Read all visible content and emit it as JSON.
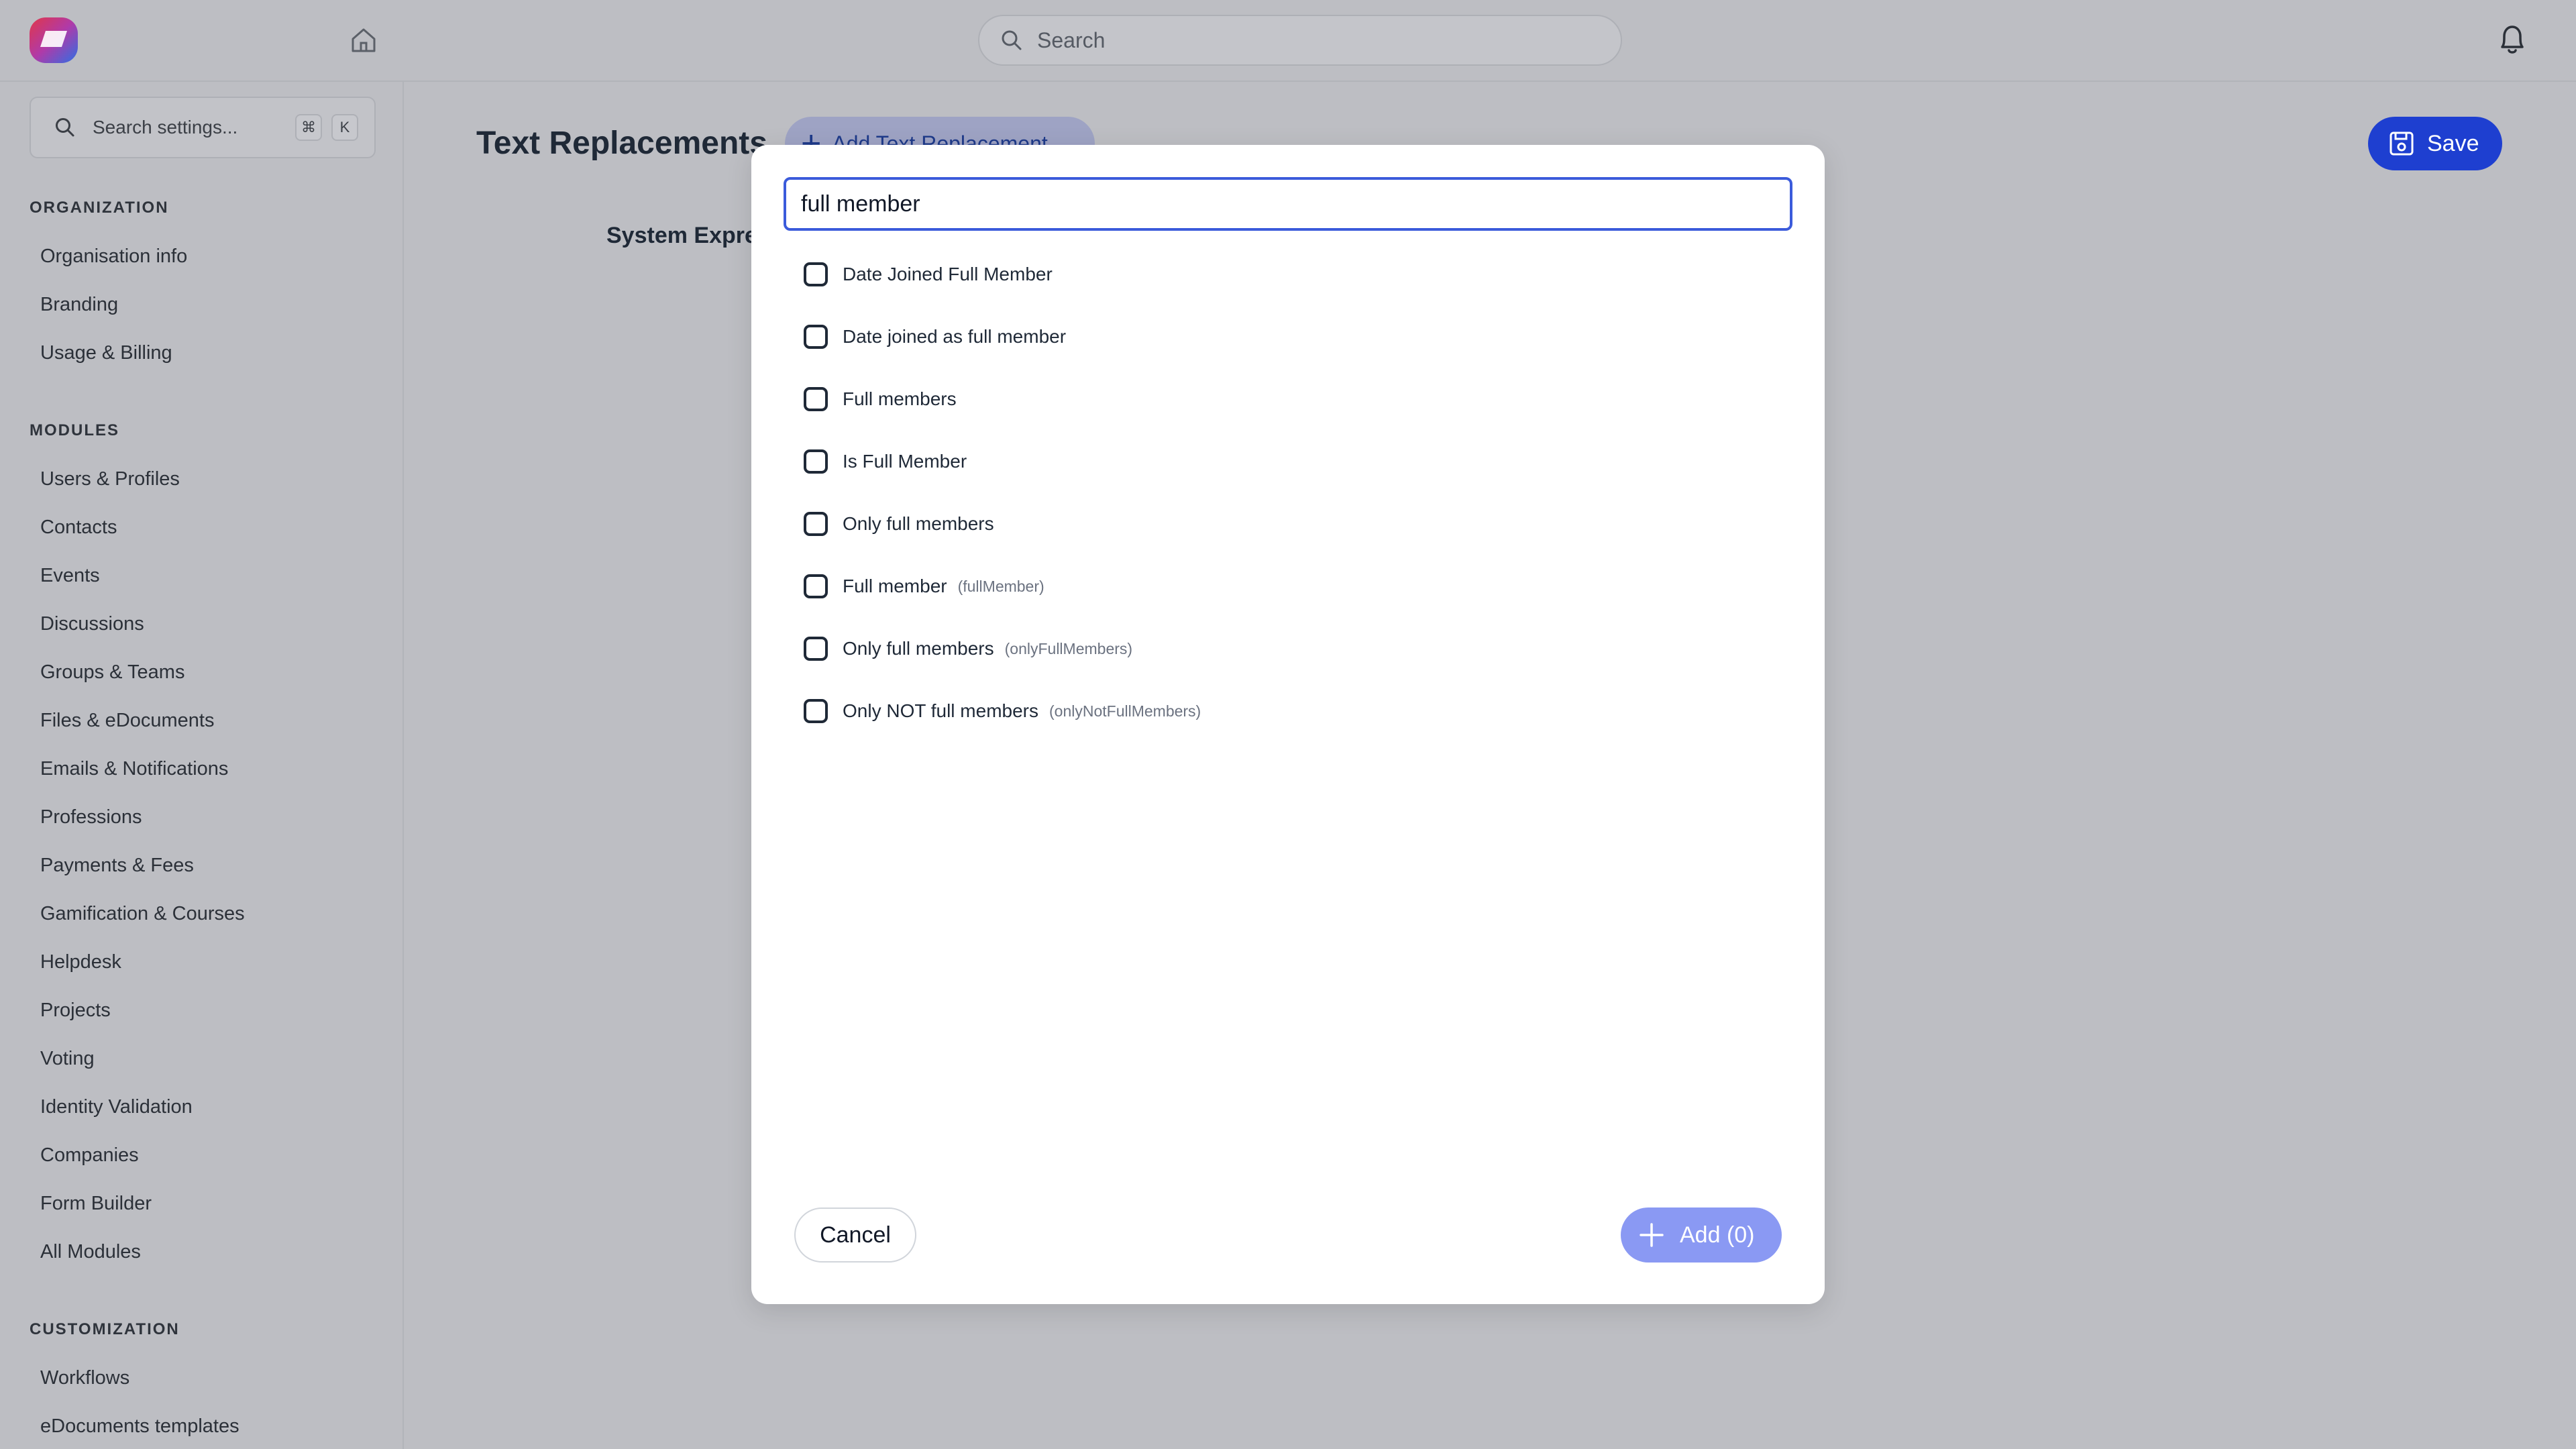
{
  "topbar": {
    "search_placeholder": "Search"
  },
  "sidebar": {
    "search_placeholder": "Search settings...",
    "shortcut_keys": [
      "⌘",
      "K"
    ],
    "sections": [
      {
        "title": "ORGANIZATION",
        "items": [
          "Organisation info",
          "Branding",
          "Usage & Billing"
        ]
      },
      {
        "title": "MODULES",
        "items": [
          "Users & Profiles",
          "Contacts",
          "Events",
          "Discussions",
          "Groups & Teams",
          "Files & eDocuments",
          "Emails & Notifications",
          "Professions",
          "Payments & Fees",
          "Gamification & Courses",
          "Helpdesk",
          "Projects",
          "Voting",
          "Identity Validation",
          "Companies",
          "Form Builder",
          "All Modules"
        ]
      },
      {
        "title": "CUSTOMIZATION",
        "items": [
          "Workflows",
          "eDocuments templates"
        ]
      }
    ]
  },
  "main": {
    "title": "Text Replacements",
    "add_button_label": "Add Text Replacement",
    "section_label": "System Expressions",
    "save_label": "Save"
  },
  "modal": {
    "search_value": "full member",
    "options": [
      {
        "label": "Date Joined Full Member",
        "key": "",
        "checked": false
      },
      {
        "label": "Date joined as full member",
        "key": "",
        "checked": false
      },
      {
        "label": "Full members",
        "key": "",
        "checked": false
      },
      {
        "label": "Is Full Member",
        "key": "",
        "checked": false
      },
      {
        "label": "Only full members",
        "key": "",
        "checked": false
      },
      {
        "label": "Full member",
        "key": "(fullMember)",
        "checked": false
      },
      {
        "label": "Only full members",
        "key": "(onlyFullMembers)",
        "checked": false
      },
      {
        "label": "Only NOT full members",
        "key": "(onlyNotFullMembers)",
        "checked": false
      }
    ],
    "cancel_label": "Cancel",
    "add_label": "Add (0)"
  },
  "colors": {
    "accent": "#1e3fd0",
    "accent_disabled": "#8a99f3",
    "overlay_bg": "#bdbec3",
    "input_focus": "#3b5bdb"
  },
  "icons": {
    "logo": "app-logo",
    "home": "home-icon",
    "search": "search-icon",
    "bell": "bell-icon",
    "save": "floppy-disk-icon",
    "plus": "plus-icon"
  }
}
